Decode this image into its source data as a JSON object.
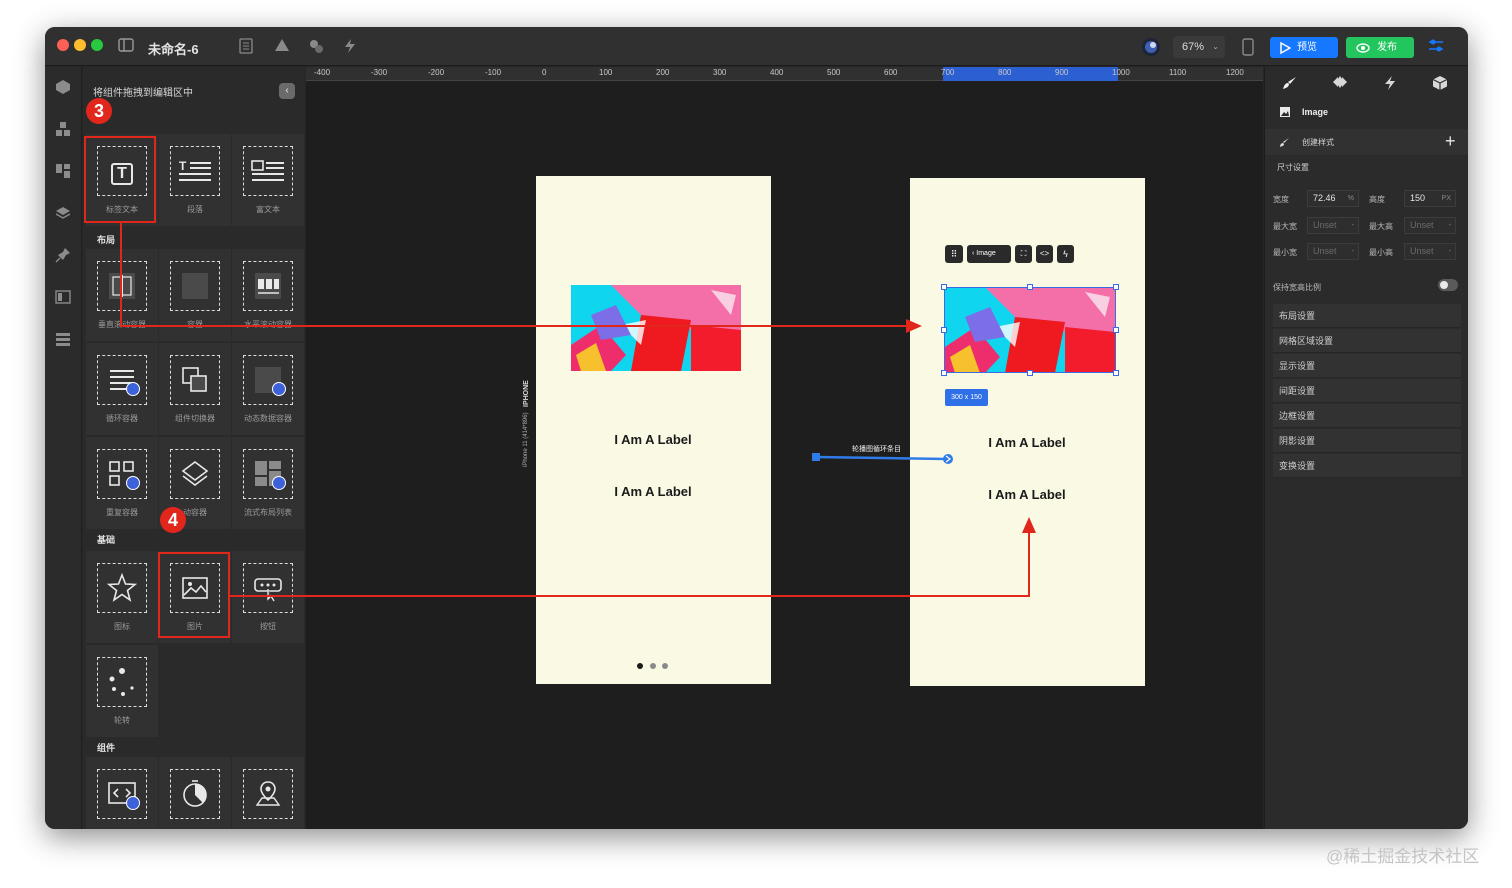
{
  "app": {
    "doc_title": "未命名-6",
    "zoom": "67%",
    "preview_label": "预览",
    "publish_label": "发布"
  },
  "panel": {
    "hint": "将组件拖拽到编辑区中",
    "sections": {
      "layout": "布局",
      "basic": "基础",
      "components": "组件"
    },
    "text_items": [
      "标签文本",
      "段落",
      "富文本"
    ],
    "layout_items": [
      "垂直滚动容器",
      "容器",
      "水平滚动容器",
      "循环容器",
      "组件切换器",
      "动态数据容器",
      "重复容器",
      "动容器",
      "流式布局列表"
    ],
    "basic_items": [
      "图标",
      "图片",
      "按钮",
      "轮转"
    ],
    "component_items": [
      "",
      "",
      ""
    ]
  },
  "ruler": {
    "ticks": [
      "-400",
      "-300",
      "-200",
      "-100",
      "0",
      "100",
      "200",
      "300",
      "400",
      "500",
      "600",
      "700",
      "800",
      "900",
      "1000",
      "1100",
      "1200"
    ]
  },
  "canvas": {
    "device_label": "IPHONE",
    "device_model": "iPhone 11 (414*896)",
    "phone_left": {
      "labels": [
        "I Am A Label",
        "I Am A Label"
      ]
    },
    "connector_label": "轮播图循环条目",
    "phone_right": {
      "labels": [
        "I Am A Label",
        "I Am A Label"
      ],
      "toolbar_image": "Image",
      "size_badge": "300 x 150"
    }
  },
  "annotations": {
    "step3": "3",
    "step4": "4",
    "arrow_color": "#e1261c"
  },
  "inspector": {
    "selected_type": "Image",
    "create_style": "创建样式",
    "size_section": "尺寸设置",
    "fields": {
      "width_label": "宽度",
      "width_value": "72.46",
      "width_unit": "%",
      "height_label": "高度",
      "height_value": "150",
      "height_unit": "PX",
      "max_w_label": "最大宽",
      "max_w_value": "Unset",
      "max_h_label": "最大高",
      "max_h_value": "Unset",
      "min_w_label": "最小宽",
      "min_w_value": "Unset",
      "min_h_label": "最小高",
      "min_h_value": "Unset",
      "aspect_label": "保持宽高比例"
    },
    "groups": [
      "布局设置",
      "网格区域设置",
      "显示设置",
      "间距设置",
      "边框设置",
      "阴影设置",
      "变换设置"
    ]
  },
  "watermark": "@稀土掘金技术社区",
  "colors": {
    "accent": "#1677ff",
    "publish": "#22c55e",
    "phone_bg": "#fafae4",
    "annotation": "#e1261c"
  }
}
